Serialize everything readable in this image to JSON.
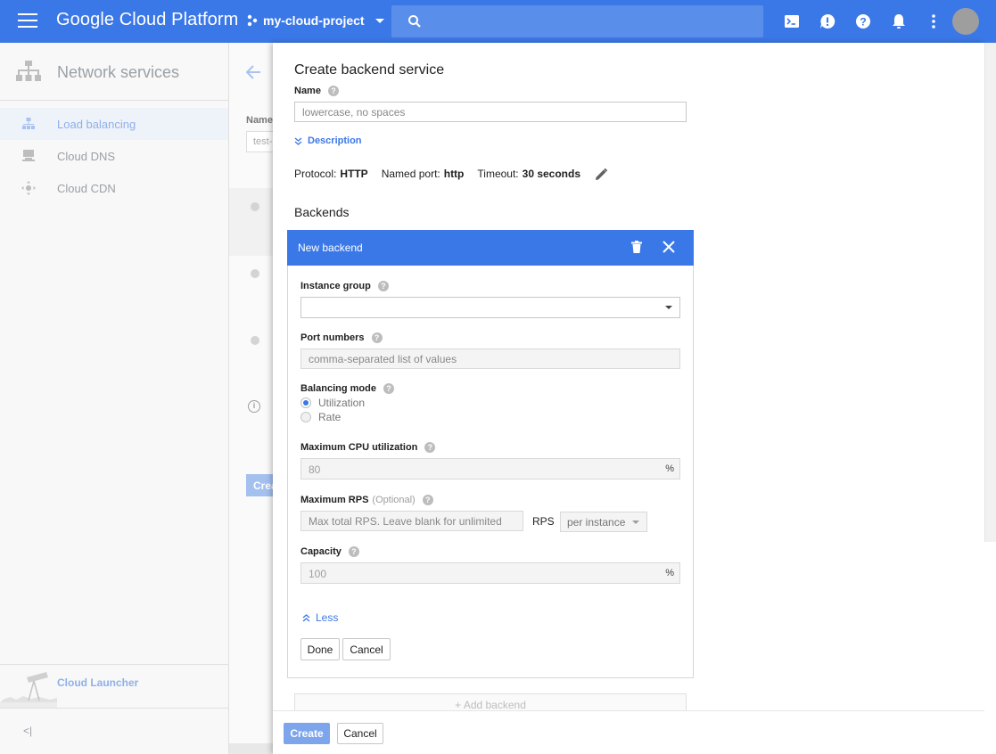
{
  "topbar": {
    "brand": "Google Cloud Platform",
    "project": "my-cloud-project",
    "accent_color": "#3b78e7"
  },
  "leftnav": {
    "title": "Network services",
    "items": [
      {
        "label": "Load balancing",
        "icon": "load-balancing-icon",
        "active": true
      },
      {
        "label": "Cloud DNS",
        "icon": "dns-icon",
        "active": false
      },
      {
        "label": "Cloud CDN",
        "icon": "cdn-icon",
        "active": false
      }
    ],
    "launcher_label": "Cloud Launcher",
    "collapse_icon": "<|"
  },
  "midpanel": {
    "name_label": "Name",
    "name_value": "test-",
    "create_label": "Crea"
  },
  "form": {
    "title": "Create backend service",
    "name_label": "Name",
    "name_placeholder": "lowercase, no spaces",
    "description_link": "Description",
    "protocol_label": "Protocol:",
    "protocol_value": "HTTP",
    "named_port_label": "Named port:",
    "named_port_value": "http",
    "timeout_label": "Timeout:",
    "timeout_value": "30 seconds",
    "backends_heading": "Backends",
    "add_backend_label": "Add backend",
    "create_button": "Create",
    "cancel_button": "Cancel"
  },
  "backend_card": {
    "title": "New backend",
    "instance_group_label": "Instance group",
    "instance_group_value": "",
    "port_numbers_label": "Port numbers",
    "port_numbers_placeholder": "comma-separated list of values",
    "balancing_mode_label": "Balancing mode",
    "balancing_modes": [
      {
        "label": "Utilization",
        "selected": true
      },
      {
        "label": "Rate",
        "selected": false
      }
    ],
    "max_cpu_label": "Maximum CPU utilization",
    "max_cpu_value": "80",
    "max_cpu_unit": "%",
    "max_rps_label": "Maximum RPS",
    "max_rps_optional": "(Optional)",
    "max_rps_placeholder": "Max total RPS. Leave blank for unlimited",
    "rps_unit": "RPS",
    "rps_scope": "per instance",
    "capacity_label": "Capacity",
    "capacity_value": "100",
    "capacity_unit": "%",
    "less_link": "Less",
    "done_button": "Done",
    "cancel_button": "Cancel"
  }
}
